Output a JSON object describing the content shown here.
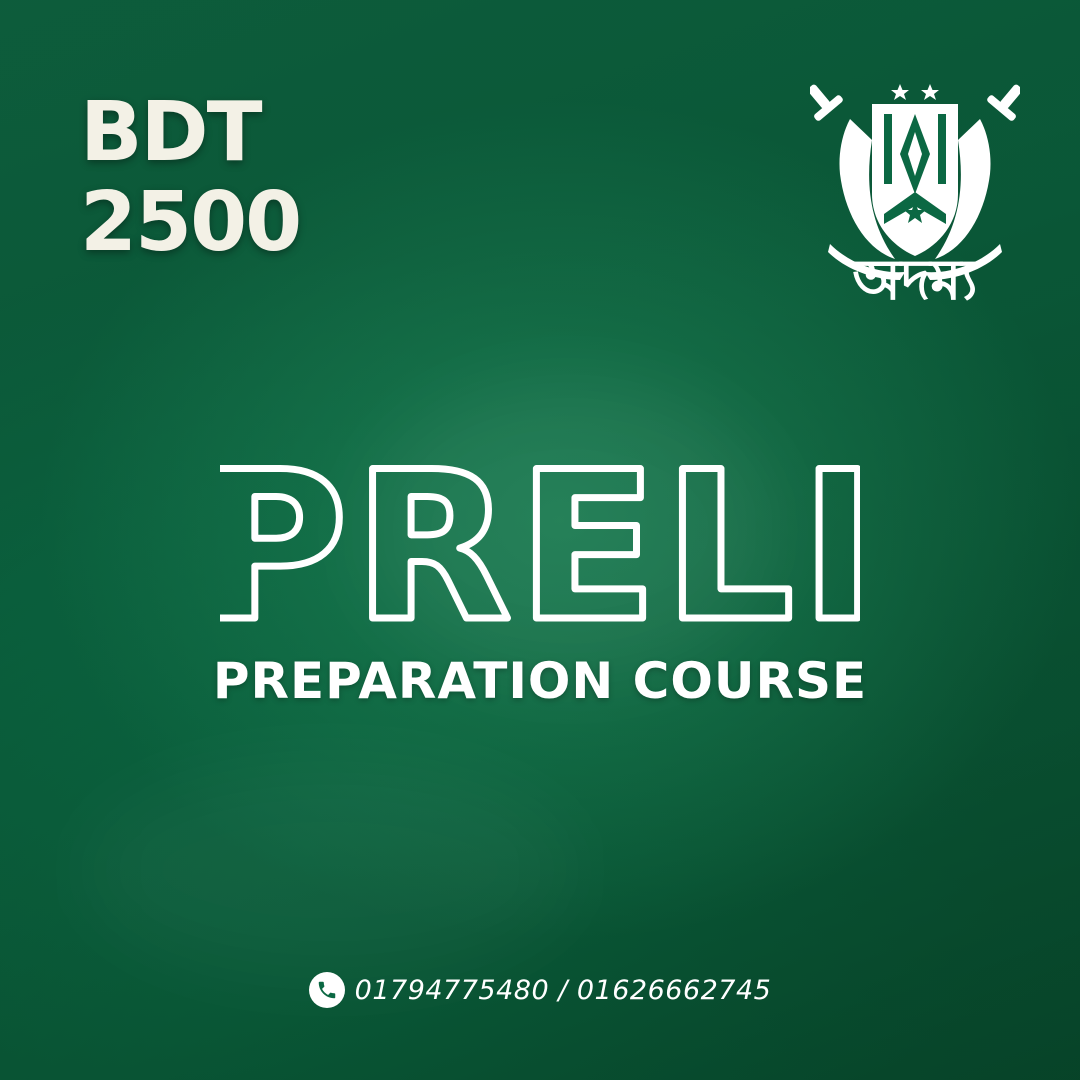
{
  "poster": {
    "price": {
      "currency": "BDT",
      "amount": "2500"
    },
    "brand": {
      "name": "অদম্য",
      "emblem": "crossed-swords-shield-emblem"
    },
    "title": "PRELI",
    "subtitle": "PREPARATION COURSE",
    "contact": {
      "icon": "phone-icon",
      "numbers": "01794775480 / 01626662745"
    },
    "colors": {
      "background": "#0b6843",
      "text": "#ffffff",
      "price_text": "#f3f1e6"
    }
  }
}
